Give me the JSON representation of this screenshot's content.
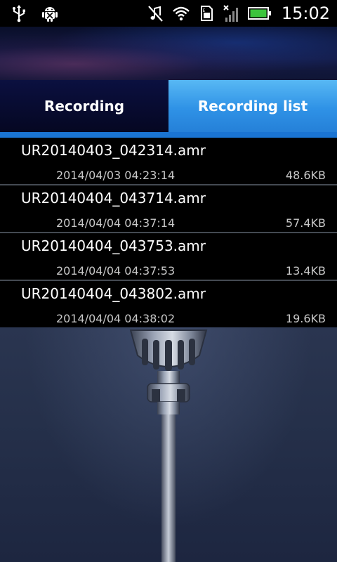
{
  "status_bar": {
    "time": "15:02",
    "icons": [
      "usb-icon",
      "android-debug-icon",
      "mute-icon",
      "wifi-icon",
      "sim-icon",
      "signal-icon",
      "battery-icon"
    ]
  },
  "tabs": [
    {
      "label": "Recording",
      "selected": false
    },
    {
      "label": "Recording list",
      "selected": true
    }
  ],
  "files": [
    {
      "name": "UR20140403_042314.amr",
      "date": "2014/04/03 04:23:14",
      "size": "48.6KB"
    },
    {
      "name": "UR20140404_043714.amr",
      "date": "2014/04/04 04:37:14",
      "size": "57.4KB"
    },
    {
      "name": "UR20140404_043753.amr",
      "date": "2014/04/04 04:37:53",
      "size": "13.4KB"
    },
    {
      "name": "UR20140404_043802.amr",
      "date": "2014/04/04 04:38:02",
      "size": "19.6KB"
    }
  ],
  "colors": {
    "tab_selected": "#2f92e6",
    "tab_unselected": "#0b1040",
    "list_bg": "#000000",
    "battery": "#3cc43c"
  }
}
